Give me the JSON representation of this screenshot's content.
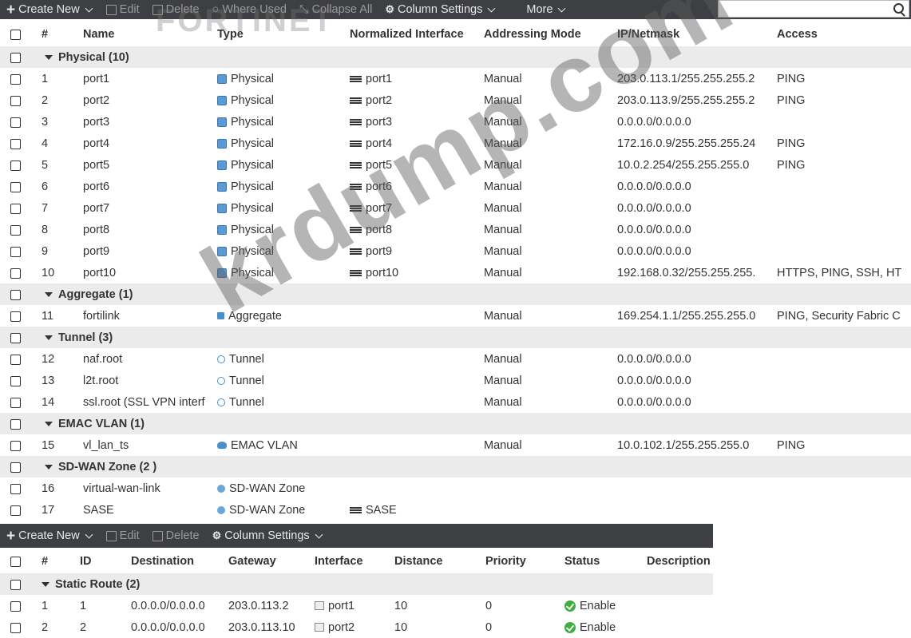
{
  "toolbar": {
    "create_new": "Create New",
    "edit": "Edit",
    "delete": "Delete",
    "where_used": "Where Used",
    "collapse_all": "Collapse All",
    "column_settings": "Column Settings",
    "more": "More",
    "search_placeholder": ""
  },
  "interfaces": {
    "columns": [
      "#",
      "Name",
      "Type",
      "Normalized Interface",
      "Addressing Mode",
      "IP/Netmask",
      "Access"
    ],
    "groups": [
      {
        "label": "Physical (10)",
        "rows": [
          {
            "num": "1",
            "name": "port1",
            "type": "Physical",
            "type_icon": "physical-icon",
            "norm": "port1",
            "mode": "Manual",
            "ip": "203.0.113.1/255.255.255.2",
            "access": "PING"
          },
          {
            "num": "2",
            "name": "port2",
            "type": "Physical",
            "type_icon": "physical-icon",
            "norm": "port2",
            "mode": "Manual",
            "ip": "203.0.113.9/255.255.255.2",
            "access": "PING"
          },
          {
            "num": "3",
            "name": "port3",
            "type": "Physical",
            "type_icon": "physical-icon",
            "norm": "port3",
            "mode": "Manual",
            "ip": "0.0.0.0/0.0.0.0",
            "access": ""
          },
          {
            "num": "4",
            "name": "port4",
            "type": "Physical",
            "type_icon": "physical-icon",
            "norm": "port4",
            "mode": "Manual",
            "ip": "172.16.0.9/255.255.255.24",
            "access": "PING"
          },
          {
            "num": "5",
            "name": "port5",
            "type": "Physical",
            "type_icon": "physical-icon",
            "norm": "port5",
            "mode": "Manual",
            "ip": "10.0.2.254/255.255.255.0",
            "access": "PING"
          },
          {
            "num": "6",
            "name": "port6",
            "type": "Physical",
            "type_icon": "physical-icon",
            "norm": "port6",
            "mode": "Manual",
            "ip": "0.0.0.0/0.0.0.0",
            "access": ""
          },
          {
            "num": "7",
            "name": "port7",
            "type": "Physical",
            "type_icon": "physical-icon",
            "norm": "port7",
            "mode": "Manual",
            "ip": "0.0.0.0/0.0.0.0",
            "access": ""
          },
          {
            "num": "8",
            "name": "port8",
            "type": "Physical",
            "type_icon": "physical-icon",
            "norm": "port8",
            "mode": "Manual",
            "ip": "0.0.0.0/0.0.0.0",
            "access": ""
          },
          {
            "num": "9",
            "name": "port9",
            "type": "Physical",
            "type_icon": "physical-icon",
            "norm": "port9",
            "mode": "Manual",
            "ip": "0.0.0.0/0.0.0.0",
            "access": ""
          },
          {
            "num": "10",
            "name": "port10",
            "type": "Physical",
            "type_icon": "physical-icon",
            "norm": "port10",
            "mode": "Manual",
            "ip": "192.168.0.32/255.255.255.",
            "access": "HTTPS, PING, SSH, HT"
          }
        ]
      },
      {
        "label": "Aggregate (1)",
        "rows": [
          {
            "num": "11",
            "name": "fortilink",
            "type": "Aggregate",
            "type_icon": "aggregate-icon",
            "norm": "",
            "mode": "Manual",
            "ip": "169.254.1.1/255.255.255.0",
            "access": "PING, Security Fabric C"
          }
        ]
      },
      {
        "label": "Tunnel (3)",
        "rows": [
          {
            "num": "12",
            "name": "naf.root",
            "type": "Tunnel",
            "type_icon": "tunnel-icon",
            "norm": "",
            "mode": "Manual",
            "ip": "0.0.0.0/0.0.0.0",
            "access": ""
          },
          {
            "num": "13",
            "name": "l2t.root",
            "type": "Tunnel",
            "type_icon": "tunnel-icon",
            "norm": "",
            "mode": "Manual",
            "ip": "0.0.0.0/0.0.0.0",
            "access": ""
          },
          {
            "num": "14",
            "name": "ssl.root (SSL VPN interf",
            "type": "Tunnel",
            "type_icon": "tunnel-icon",
            "norm": "",
            "mode": "Manual",
            "ip": "0.0.0.0/0.0.0.0",
            "access": ""
          }
        ]
      },
      {
        "label": "EMAC VLAN (1)",
        "rows": [
          {
            "num": "15",
            "name": "vl_lan_ts",
            "type": "EMAC VLAN",
            "type_icon": "emac-vlan-icon",
            "norm": "",
            "mode": "Manual",
            "ip": "10.0.102.1/255.255.255.0",
            "access": "PING"
          }
        ]
      },
      {
        "label": "SD-WAN Zone (2 )",
        "rows": [
          {
            "num": "16",
            "name": "virtual-wan-link",
            "type": "SD-WAN Zone",
            "type_icon": "sdwan-zone-icon",
            "norm": "",
            "mode": "",
            "ip": "",
            "access": ""
          },
          {
            "num": "17",
            "name": "SASE",
            "type": "SD-WAN Zone",
            "type_icon": "sdwan-zone-icon",
            "norm": "SASE",
            "mode": "",
            "ip": "",
            "access": ""
          }
        ]
      }
    ]
  },
  "toolbar2": {
    "create_new": "Create New",
    "edit": "Edit",
    "delete": "Delete",
    "column_settings": "Column Settings"
  },
  "routes": {
    "columns": [
      "#",
      "ID",
      "Destination",
      "Gateway",
      "Interface",
      "Distance",
      "Priority",
      "Status",
      "Description"
    ],
    "group_label": "Static Route (2)",
    "rows": [
      {
        "num": "1",
        "id": "1",
        "dest": "0.0.0.0/0.0.0.0",
        "gw": "203.0.113.2",
        "iface": "port1",
        "dist": "10",
        "prio": "0",
        "status": "Enable"
      },
      {
        "num": "2",
        "id": "2",
        "dest": "0.0.0.0/0.0.0.0",
        "gw": "203.0.113.10",
        "iface": "port2",
        "dist": "10",
        "prio": "0",
        "status": "Enable"
      }
    ]
  },
  "watermark": "krdump.com",
  "logo_watermark": "FORTINET",
  "colors": {
    "toolbar_bg": "#3d3f42",
    "group_bg": "#ebebeb",
    "icon_blue": "#5b9bd5",
    "enable_green": "#3eae3e"
  }
}
